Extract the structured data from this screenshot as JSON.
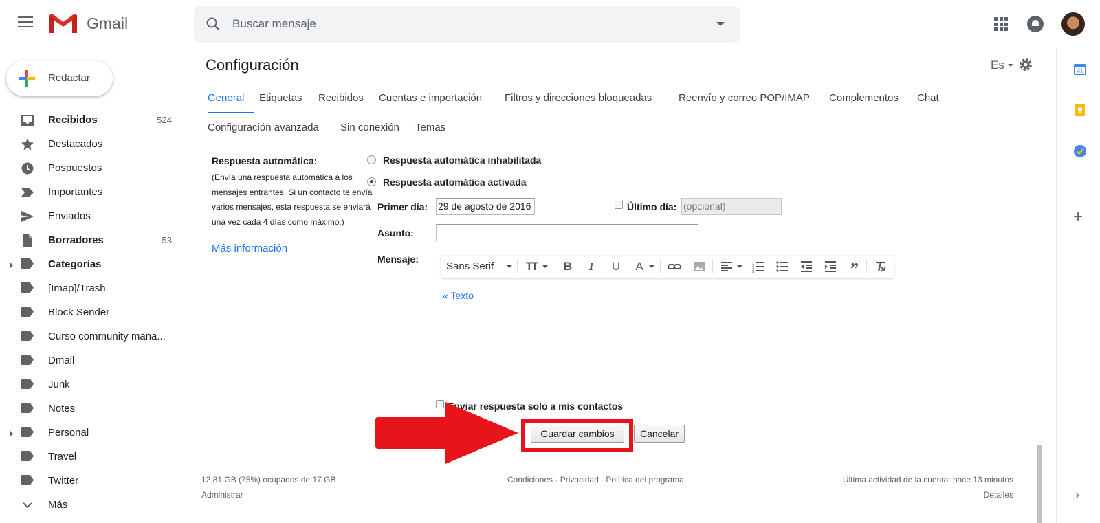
{
  "header": {
    "app_name": "Gmail",
    "search_placeholder": "Buscar mensaje"
  },
  "sidebar": {
    "compose_label": "Redactar",
    "items": [
      {
        "label": "Recibidos",
        "count": "524",
        "bold": true,
        "icon": "inbox-icon"
      },
      {
        "label": "Destacados",
        "count": "",
        "bold": false,
        "icon": "star-icon"
      },
      {
        "label": "Pospuestos",
        "count": "",
        "bold": false,
        "icon": "clock-icon"
      },
      {
        "label": "Importantes",
        "count": "",
        "bold": false,
        "icon": "important-icon"
      },
      {
        "label": "Enviados",
        "count": "",
        "bold": false,
        "icon": "send-icon"
      },
      {
        "label": "Borradores",
        "count": "53",
        "bold": true,
        "icon": "draft-icon"
      },
      {
        "label": "Categorías",
        "count": "",
        "bold": true,
        "icon": "label-icon"
      },
      {
        "label": "[Imap]/Trash",
        "count": "",
        "bold": false,
        "icon": "label-icon"
      },
      {
        "label": "Block Sender",
        "count": "",
        "bold": false,
        "icon": "label-icon"
      },
      {
        "label": "Curso community mana...",
        "count": "",
        "bold": false,
        "icon": "label-icon"
      },
      {
        "label": "Dmail",
        "count": "",
        "bold": false,
        "icon": "label-icon"
      },
      {
        "label": "Junk",
        "count": "",
        "bold": false,
        "icon": "label-icon"
      },
      {
        "label": "Notes",
        "count": "",
        "bold": false,
        "icon": "label-icon"
      },
      {
        "label": "Personal",
        "count": "",
        "bold": false,
        "icon": "label-icon"
      },
      {
        "label": "Travel",
        "count": "",
        "bold": false,
        "icon": "label-icon"
      },
      {
        "label": "Twitter",
        "count": "",
        "bold": false,
        "icon": "label-icon"
      },
      {
        "label": "Más",
        "count": "",
        "bold": false,
        "icon": "chevron-down-icon"
      }
    ]
  },
  "main": {
    "title": "Configuración",
    "language": "Es",
    "tabs_row1": [
      "General",
      "Etiquetas",
      "Recibidos",
      "Cuentas e importación",
      "Filtros y direcciones bloqueadas",
      "Reenvío y correo POP/IMAP",
      "Complementos",
      "Chat"
    ],
    "tabs_row2": [
      "Configuración avanzada",
      "Sin conexión",
      "Temas"
    ],
    "vacation": {
      "title": "Respuesta automática:",
      "description": "(Envía una respuesta automática a los mensajes entrantes. Si un contacto te envía varios mensajes, esta respuesta se enviará una vez cada 4 días como máximo.)",
      "more_info": "Más información",
      "option_off": "Respuesta automática inhabilitada",
      "option_on": "Respuesta automática activada",
      "first_day_label": "Primer día:",
      "first_day_value": "29 de agosto de 2016",
      "last_day_label": "Último día:",
      "last_day_placeholder": "(opcional)",
      "subject_label": "Asunto:",
      "subject_value": "",
      "message_label": "Mensaje:",
      "font_name": "Sans Serif",
      "plain_text_link": "« Texto",
      "contacts_only_label": "Enviar respuesta solo a mis contactos"
    },
    "save_button": "Guardar cambios",
    "cancel_button": "Cancelar"
  },
  "footer": {
    "storage": "12,81 GB (75%) ocupados de 17 GB",
    "manage": "Administrar",
    "terms": "Condiciones",
    "privacy": "Privacidad",
    "policy": "Política del programa",
    "activity": "Última actividad de la cuenta: hace 13 minutos",
    "details": "Detalles"
  },
  "side_panel": {
    "calendar_day": "31"
  },
  "colors": {
    "accent": "#1a73e8",
    "highlight_red": "#e8141c"
  }
}
